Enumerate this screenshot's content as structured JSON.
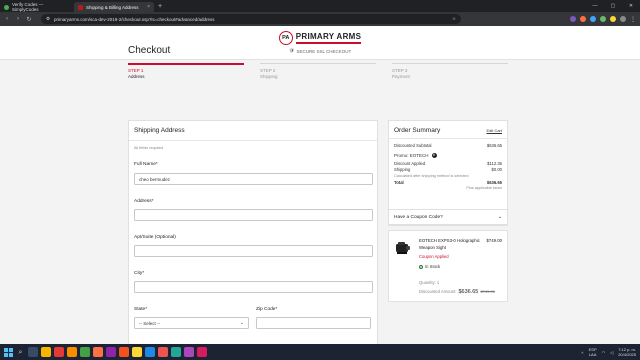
{
  "browser": {
    "tabs": [
      {
        "title": "Verify Codes — SimplyCodes",
        "active": false
      },
      {
        "title": "Shipping & Billing Address",
        "active": true
      }
    ],
    "url": "primaryarms.com/sca-dev-2019-2/checkout.ssp?is=checkout#advanced/address"
  },
  "header": {
    "logo_abbr": "PA",
    "logo_name": "PRIMARY ARMS",
    "ssl_text": "SECURE SSL CHECKOUT"
  },
  "checkout": {
    "title": "Checkout",
    "steps": [
      {
        "num": "STEP 1",
        "name": "Address",
        "active": true
      },
      {
        "num": "STEP 2",
        "name": "Shipping",
        "active": false
      },
      {
        "num": "STEP 3",
        "name": "Payment",
        "active": false
      }
    ]
  },
  "shipping": {
    "heading": "Shipping Address",
    "required_note": "All fields required",
    "full_name_label": "Full Name*",
    "full_name_value": "cheo bermudez",
    "address_label": "Address*",
    "apt_label": "Apt/Suite (Optional)",
    "city_label": "City*",
    "state_label": "State*",
    "state_value": "-- Select --",
    "zip_label": "Zip Code*"
  },
  "summary": {
    "heading": "Order Summary",
    "edit_cart": "Edit Cart",
    "discounted_subtotal_label": "Discounted Subtotal",
    "discounted_subtotal_value": "$636.65",
    "promo_label": "Promo: EOTECH",
    "discount_label": "Discount Applied",
    "discount_value": "$112.35",
    "shipping_label": "Shipping",
    "shipping_value": "$0.00",
    "shipping_note": "Calculated after shipping method is selected",
    "total_label": "Total",
    "total_value": "$636.65",
    "tax_note": "Plus applicable taxes"
  },
  "coupon": {
    "label": "Have a Coupon Code?"
  },
  "item": {
    "name": "EOTECH EXPS3-0 Holographic Weapon Sight",
    "price": "$749.00",
    "coupon_applied": "Coupon Applied",
    "stock": "In Stock",
    "quantity": "Quantity: 1",
    "discounted_label": "Discounted Amount:",
    "discounted_value": "$636.65",
    "original_value": "$749.00"
  },
  "taskbar": {
    "lang": "ESP",
    "lang_sub": "LAA",
    "time": "7:12 p. m.",
    "date": "20/4/2025"
  }
}
